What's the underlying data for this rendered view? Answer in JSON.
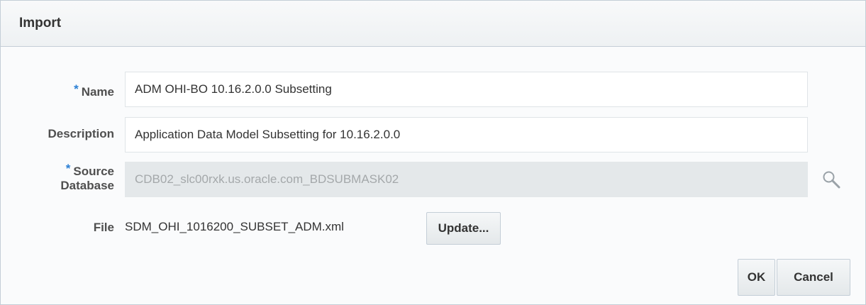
{
  "dialog": {
    "title": "Import"
  },
  "form": {
    "name": {
      "required_marker": "*",
      "label": "Name",
      "value": "ADM OHI-BO 10.16.2.0.0 Subsetting"
    },
    "description": {
      "label": "Description",
      "value": "Application Data Model Subsetting for 10.16.2.0.0"
    },
    "source_database": {
      "required_marker": "*",
      "label_line1": "Source",
      "label_line2": "Database",
      "value": "CDB02_slc00rxk.us.oracle.com_BDSUBMASK02",
      "search_icon": "search-icon"
    },
    "file": {
      "label": "File",
      "value": "SDM_OHI_1016200_SUBSET_ADM.xml",
      "update_label": "Update..."
    }
  },
  "actions": {
    "ok_label": "OK",
    "cancel_label": "Cancel"
  },
  "colors": {
    "required_marker": "#2a7fd4",
    "border": "#c4ced7",
    "readonly_bg": "#e4e8ea"
  }
}
